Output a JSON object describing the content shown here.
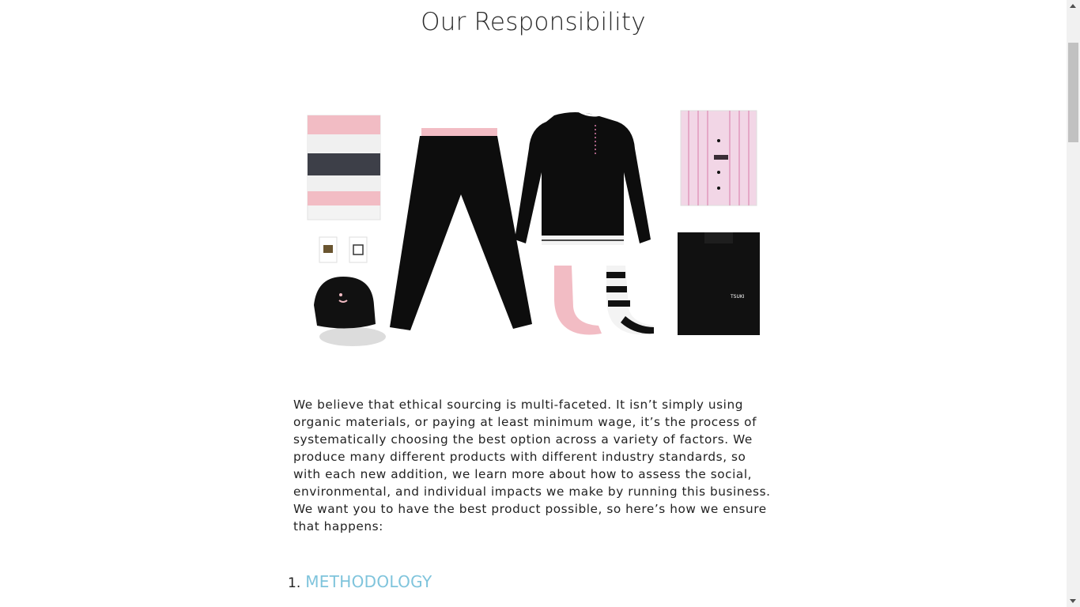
{
  "page": {
    "title": "Our Responsibility"
  },
  "hero_image": {
    "alt": "Product lineup: scarf, pins, cap, pants, sweater, socks, shirts",
    "colors": {
      "pink": "#f2bcc4",
      "black": "#111111",
      "grey": "#3d3f48",
      "white": "#f3f3f3",
      "stripe": "#d87ba8"
    }
  },
  "intro": {
    "text": "We believe that ethical sourcing is multi-faceted. It isn’t simply using organic materials, or paying at least minimum wage, it’s the process of systematically choosing the best option across a variety of factors. We produce many different products with different industry standards, so with each new addition, we learn more about how to assess the social, environmental, and individual impacts we make by running this business. We want you to have the best product possible, so here’s how we ensure that happens:"
  },
  "sections": [
    {
      "number": "1.",
      "label": "METHODOLOGY"
    }
  ],
  "colors": {
    "link": "#7fc4dc",
    "text": "#222222"
  }
}
